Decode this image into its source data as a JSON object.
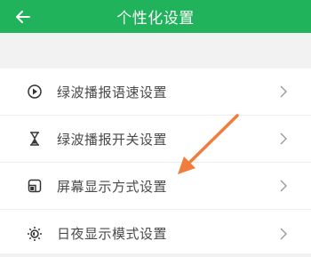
{
  "header": {
    "title": "个性化设置",
    "back_icon": "arrow-left-icon",
    "background": "#21b35b"
  },
  "settings": {
    "items": [
      {
        "label": "绿波播报语速设置",
        "icon": "speed-play-icon"
      },
      {
        "label": "绿波播报开关设置",
        "icon": "hourglass-icon"
      },
      {
        "label": "屏幕显示方式设置",
        "icon": "screen-display-icon"
      },
      {
        "label": "日夜显示模式设置",
        "icon": "day-night-icon"
      }
    ],
    "chevron_icon": "chevron-right-icon"
  },
  "annotation": {
    "color": "#f07d3c",
    "icon": "orange-arrow-pointer"
  }
}
